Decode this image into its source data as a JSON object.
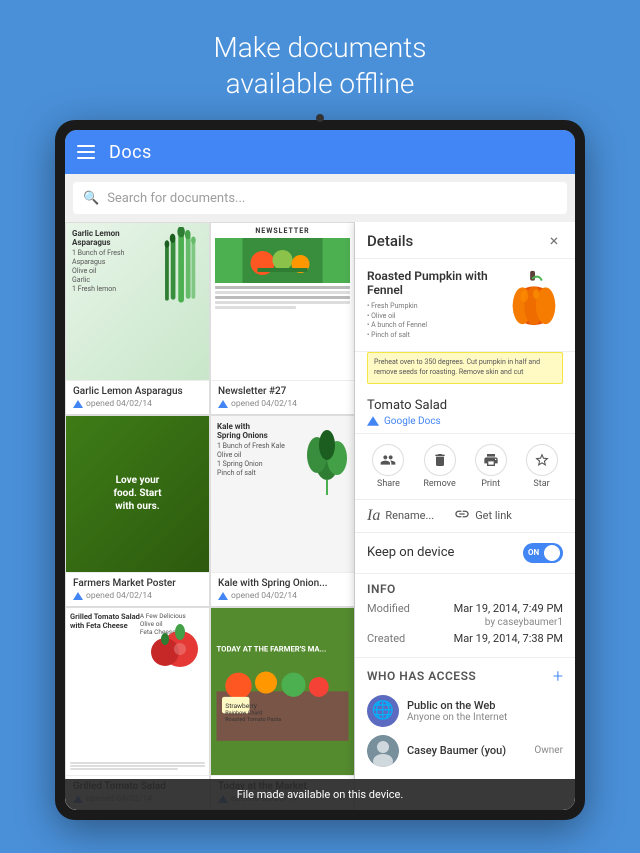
{
  "hero": {
    "line1": "Make documents",
    "line2": "available offline"
  },
  "docs_app": {
    "header": {
      "title": "Docs"
    },
    "search": {
      "placeholder": "Search for documents..."
    },
    "documents": [
      {
        "id": "doc1",
        "name": "Garlic Lemon Asparagus",
        "meta": "opened 04/02/14",
        "type": "asparagus"
      },
      {
        "id": "doc2",
        "name": "Newsletter #27",
        "meta": "opened 04/02/14",
        "type": "newsletter"
      },
      {
        "id": "doc3",
        "name": "Farmers Market Poster",
        "meta": "opened 04/02/14",
        "type": "market"
      },
      {
        "id": "doc4",
        "name": "Kale with Spring Onion...",
        "meta": "opened 04/02/14",
        "type": "kale"
      },
      {
        "id": "doc5",
        "name": "Grilled Tomato Salad",
        "meta": "opened 04/02/14",
        "type": "tomato"
      },
      {
        "id": "doc6",
        "name": "Today at the Market",
        "meta": "opened 03/20/14",
        "type": "market2"
      }
    ]
  },
  "details_panel": {
    "title": "Details",
    "close_label": "×",
    "recipe": {
      "title": "Roasted Pumpkin with Fennel",
      "ingredients": "• Fresh Pumpkin\n• Olive oil\n• A bunch of Fennel\n• Pinch of salt",
      "description": "Preheat oven to 350 degrees. Cut pumpkin in half and remove seeds for roasting. Remove skin and cut"
    },
    "linked_doc": {
      "title": "Tomato Salad",
      "source": "Google Docs"
    },
    "actions": [
      {
        "icon": "👥",
        "label": "Share"
      },
      {
        "icon": "🗑",
        "label": "Remove"
      },
      {
        "icon": "🖨",
        "label": "Print"
      },
      {
        "icon": "☆",
        "label": "Star"
      }
    ],
    "link_actions": [
      {
        "icon": "Ia",
        "label": "Rename..."
      },
      {
        "icon": "🔗",
        "label": "Get link"
      }
    ],
    "keep_on_device": {
      "label": "Keep on device",
      "toggle_state": "ON"
    },
    "info": {
      "section_title": "Info",
      "modified_label": "Modified",
      "modified_value": "Mar 19, 2014, 7:49 PM",
      "modified_by": "by caseybaumer1",
      "created_label": "Created",
      "created_value": "Mar 19, 2014, 7:38 PM"
    },
    "access": {
      "section_title": "Who has access",
      "people": [
        {
          "name": "Public on the Web",
          "desc": "Anyone on the Internet",
          "role": "",
          "type": "globe"
        },
        {
          "name": "Casey Baumer (you)",
          "desc": "",
          "role": "Owner",
          "type": "photo"
        }
      ]
    }
  },
  "toast": {
    "message": "File made available on this device."
  }
}
